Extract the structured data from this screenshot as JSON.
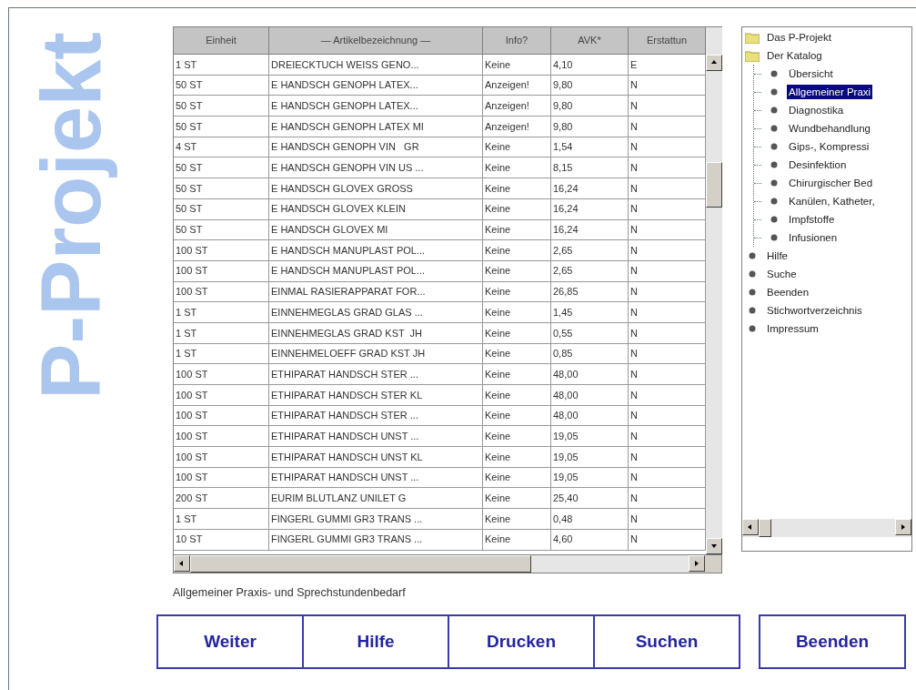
{
  "logo": {
    "text": "P-Projekt"
  },
  "table": {
    "columns": [
      "Einheit",
      "— Artikelbezeichnung —",
      "Info?",
      "AVK*",
      "Erstattun"
    ],
    "rows": [
      [
        "1 ST",
        "DREIECKTUCH WEISS GENO...",
        "Keine",
        "4,10",
        "E"
      ],
      [
        "50 ST",
        "E HANDSCH GENOPH LATEX...",
        "Anzeigen!",
        "9,80",
        "N"
      ],
      [
        "50 ST",
        "E HANDSCH GENOPH LATEX...",
        "Anzeigen!",
        "9,80",
        "N"
      ],
      [
        "50 ST",
        "E HANDSCH GENOPH LATEX MI",
        "Anzeigen!",
        "9,80",
        "N"
      ],
      [
        "4 ST",
        "E HANDSCH GENOPH VIN   GR",
        "Keine",
        "1,54",
        "N"
      ],
      [
        "50 ST",
        "E HANDSCH GENOPH VIN US ...",
        "Keine",
        "8,15",
        "N"
      ],
      [
        "50 ST",
        "E HANDSCH GLOVEX GROSS",
        "Keine",
        "16,24",
        "N"
      ],
      [
        "50 ST",
        "E HANDSCH GLOVEX KLEIN",
        "Keine",
        "16,24",
        "N"
      ],
      [
        "50 ST",
        "E HANDSCH GLOVEX MI",
        "Keine",
        "16,24",
        "N"
      ],
      [
        "100 ST",
        "E HANDSCH MANUPLAST POL...",
        "Keine",
        "2,65",
        "N"
      ],
      [
        "100 ST",
        "E HANDSCH MANUPLAST POL...",
        "Keine",
        "2,65",
        "N"
      ],
      [
        "100 ST",
        "EINMAL RASIERAPPARAT FOR...",
        "Keine",
        "26,85",
        "N"
      ],
      [
        "1 ST",
        "EINNEHMEGLAS GRAD GLAS ...",
        "Keine",
        "1,45",
        "N"
      ],
      [
        "1 ST",
        "EINNEHMEGLAS GRAD KST  JH",
        "Keine",
        "0,55",
        "N"
      ],
      [
        "1 ST",
        "EINNEHMELOEFF GRAD KST JH",
        "Keine",
        "0,85",
        "N"
      ],
      [
        "100 ST",
        "ETHIPARAT HANDSCH STER ...",
        "Keine",
        "48,00",
        "N"
      ],
      [
        "100 ST",
        "ETHIPARAT HANDSCH STER KL",
        "Keine",
        "48,00",
        "N"
      ],
      [
        "100 ST",
        "ETHIPARAT HANDSCH STER ...",
        "Keine",
        "48,00",
        "N"
      ],
      [
        "100 ST",
        "ETHIPARAT HANDSCH UNST ...",
        "Keine",
        "19,05",
        "N"
      ],
      [
        "100 ST",
        "ETHIPARAT HANDSCH UNST KL",
        "Keine",
        "19,05",
        "N"
      ],
      [
        "100 ST",
        "ETHIPARAT HANDSCH UNST ...",
        "Keine",
        "19,05",
        "N"
      ],
      [
        "200 ST",
        "EURIM BLUTLANZ UNILET G",
        "Keine",
        "25,40",
        "N"
      ],
      [
        "1 ST",
        "FINGERL GUMMI GR3 TRANS ...",
        "Keine",
        "0,48",
        "N"
      ],
      [
        "10 ST",
        "FINGERL GUMMI GR3 TRANS ...",
        "Keine",
        "4,60",
        "N"
      ]
    ]
  },
  "tree": [
    {
      "label": "Das P-Projekt",
      "kind": "folder",
      "selected": false
    },
    {
      "label": "Der Katalog",
      "kind": "folder",
      "selected": false,
      "children": [
        {
          "label": "Übersicht",
          "kind": "leaf",
          "selected": false
        },
        {
          "label": "Allgemeiner Praxi",
          "kind": "leaf",
          "selected": true
        },
        {
          "label": "Diagnostika",
          "kind": "leaf",
          "selected": false
        },
        {
          "label": "Wundbehandlung",
          "kind": "leaf",
          "selected": false
        },
        {
          "label": "Gips-, Kompressi",
          "kind": "leaf",
          "selected": false
        },
        {
          "label": "Desinfektion",
          "kind": "leaf",
          "selected": false
        },
        {
          "label": "Chirurgischer Bed",
          "kind": "leaf",
          "selected": false
        },
        {
          "label": "Kanülen, Katheter,",
          "kind": "leaf",
          "selected": false
        },
        {
          "label": "Impfstoffe",
          "kind": "leaf",
          "selected": false
        },
        {
          "label": "Infusionen",
          "kind": "leaf",
          "selected": false
        }
      ]
    },
    {
      "label": "Hilfe",
      "kind": "leaf",
      "selected": false
    },
    {
      "label": "Suche",
      "kind": "leaf",
      "selected": false
    },
    {
      "label": "Beenden",
      "kind": "leaf",
      "selected": false
    },
    {
      "label": "Stichwortverzeichnis",
      "kind": "leaf",
      "selected": false
    },
    {
      "label": "Impressum",
      "kind": "leaf",
      "selected": false
    }
  ],
  "caption": "Allgemeiner Praxis- und Sprechstundenbedarf",
  "buttons": [
    "Weiter",
    "Hilfe",
    "Drucken",
    "Suchen"
  ],
  "exit_button": "Beenden"
}
